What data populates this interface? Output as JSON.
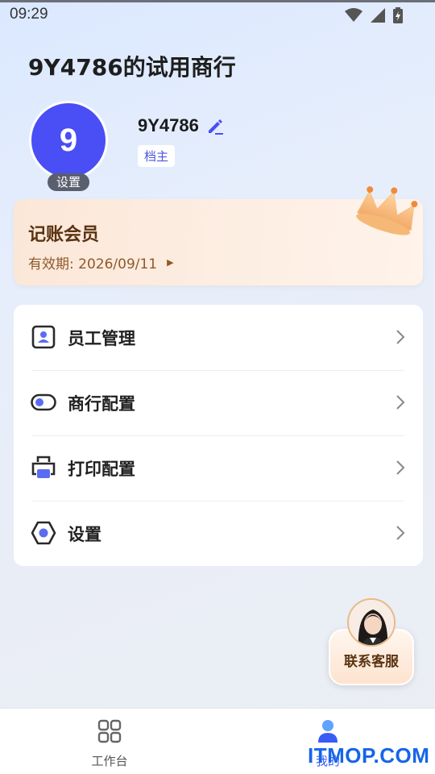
{
  "status_bar": {
    "time": "09:29"
  },
  "header": {
    "shop_title": "9Y4786的试用商行"
  },
  "profile": {
    "avatar_letter": "9",
    "avatar_badge": "设置",
    "username": "9Y4786",
    "role": "档主"
  },
  "membership": {
    "title": "记账会员",
    "expire": "有效期: 2026/09/11"
  },
  "menu": {
    "items": [
      {
        "label": "员工管理",
        "icon": "staff-card-icon"
      },
      {
        "label": "商行配置",
        "icon": "toggle-icon"
      },
      {
        "label": "打印配置",
        "icon": "printer-icon"
      },
      {
        "label": "设置",
        "icon": "hexagon-settings-icon"
      }
    ]
  },
  "service": {
    "label": "联系客服"
  },
  "tabbar": {
    "items": [
      {
        "label": "工作台",
        "icon": "grid-icon"
      },
      {
        "label": "我的",
        "icon": "person-icon"
      }
    ]
  },
  "watermark": "ITMOP.COM",
  "colors": {
    "accent": "#4a4ef5",
    "member_text": "#5a3311",
    "tab_active": "#3b5bf5"
  }
}
